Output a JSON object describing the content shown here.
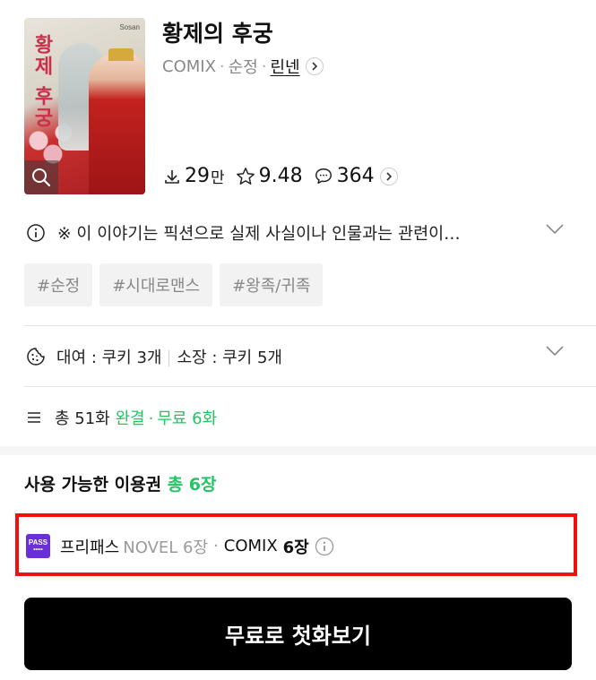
{
  "cover": {
    "title_art": "황제 후궁",
    "publisher": "Sosan"
  },
  "title": "황제의 후궁",
  "meta": {
    "format": "COMIX",
    "genre": "순정",
    "author": "린넨"
  },
  "stats": {
    "downloads_value": "29",
    "downloads_unit": "만",
    "rating": "9.48",
    "comments": "364"
  },
  "notice": {
    "text": "※ 이 이야기는 픽션으로 실제 사실이나 인물과는 관련이…"
  },
  "tags": [
    "#순정",
    "#시대로맨스",
    "#왕족/귀족"
  ],
  "rent": {
    "rent_text": "대여 : 쿠키 3개",
    "own_text": "소장 : 쿠키 5개"
  },
  "episodes": {
    "total": "총 51화",
    "completed": "완결",
    "free": "무료 6화"
  },
  "pass": {
    "heading": "사용 가능한 이용권",
    "total": "총 6장",
    "icon_label": "PASS",
    "name": "프리패스",
    "novel": "NOVEL 6장",
    "comix": "COMIX",
    "comix_count": "6장"
  },
  "cta": {
    "label": "무료로 첫화보기"
  }
}
